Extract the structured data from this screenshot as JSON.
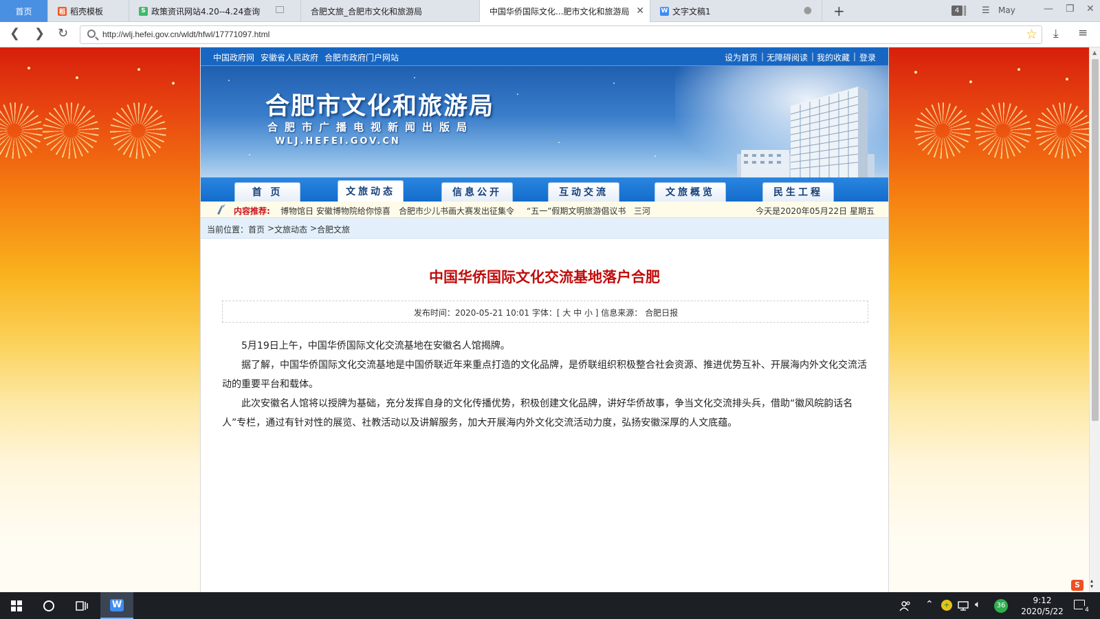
{
  "browser": {
    "tabs": [
      {
        "label": "首页",
        "type": "home"
      },
      {
        "label": "稻壳模板",
        "icon_color": "#f05a24"
      },
      {
        "label": "政策资讯网站4.20--4.24查询",
        "icon_color": "#3fb96b"
      },
      {
        "label": "合肥文旅_合肥市文化和旅游局"
      },
      {
        "label": "中国华侨国际文化...肥市文化和旅游局",
        "active": true
      },
      {
        "label": "文字文稿1",
        "icon_color": "#3f8cf3"
      }
    ],
    "tab_count": "4",
    "user_name": "May",
    "url": "http://wlj.hefei.gov.cn/wldt/hfwl/17771097.html"
  },
  "site": {
    "top_links_left": [
      "中国政府网",
      "安徽省人民政府",
      "合肥市政府门户网站"
    ],
    "top_links_right": [
      "设为首页",
      "无障碍阅读",
      "我的收藏",
      "登录"
    ],
    "banner_title": "合肥市文化和旅游局",
    "banner_subtitle": "合肥市广播电视新闻出版局",
    "banner_url": "WLJ.HEFEI.GOV.CN",
    "nav": [
      {
        "label": "首 页"
      },
      {
        "label": "文旅动态",
        "active": true
      },
      {
        "label": "信息公开"
      },
      {
        "label": "互动交流"
      },
      {
        "label": "文旅概览"
      },
      {
        "label": "民生工程"
      }
    ],
    "recommend_label": "内容推荐:",
    "recommend_items": [
      "博物馆日 安徽博物院给你惊喜",
      "合肥市少儿书画大赛发出征集令",
      "“五一”假期文明旅游倡议书",
      "三河"
    ],
    "today": "今天是2020年05月22日 星期五",
    "breadcrumb": {
      "prefix": "当前位置：",
      "items": [
        "首页",
        "文旅动态",
        "合肥文旅"
      ],
      "separator": ">"
    }
  },
  "article": {
    "title": "中国华侨国际文化交流基地落户合肥",
    "meta": "发布时间：2020-05-21 10:01  字体：[ 大 中 小 ] 信息来源： 合肥日报",
    "paragraphs": [
      "5月19日上午，中国华侨国际文化交流基地在安徽名人馆揭牌。",
      "据了解，中国华侨国际文化交流基地是中国侨联近年来重点打造的文化品牌，是侨联组织积极整合社会资源、推进优势互补、开展海内外文化交流活动的重要平台和载体。",
      "此次安徽名人馆将以授牌为基础，充分发挥自身的文化传播优势，积极创建文化品牌，讲好华侨故事，争当文化交流排头兵，借助“徽风皖韵话名人”专栏，通过有针对性的展览、社教活动以及讲解服务，加大开展海内外文化交流活动力度，弘扬安徽深厚的人文底蕴。"
    ]
  },
  "taskbar": {
    "badge_360": "36",
    "time": "9:12",
    "date": "2020/5/22",
    "notification_count": "4"
  },
  "colors": {
    "title_red": "#c00a0a",
    "nav_blue": "#1766c2",
    "accent_blue": "#4a90e2"
  }
}
